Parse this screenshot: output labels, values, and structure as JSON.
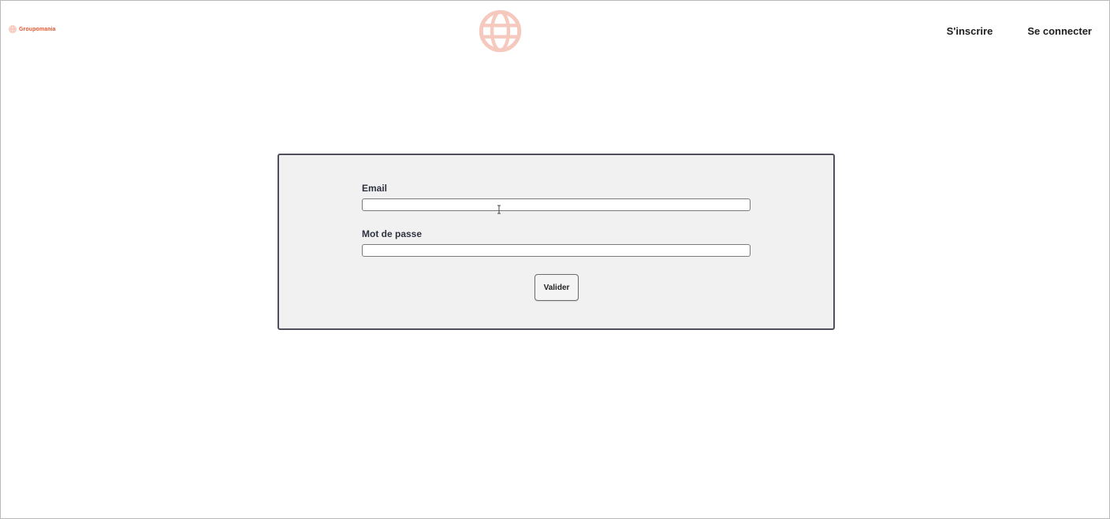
{
  "header": {
    "brand": {
      "icon": "globe-icon",
      "name": "Groupomania",
      "color": "#e8552f"
    },
    "logo": {
      "icon": "globe-icon",
      "color": "#f6c9bf"
    },
    "nav": [
      {
        "label": "S'inscrire"
      },
      {
        "label": "Se connecter"
      }
    ]
  },
  "login_form": {
    "email": {
      "label": "Email",
      "value": "",
      "placeholder": ""
    },
    "password": {
      "label": "Mot de passe",
      "value": "",
      "placeholder": ""
    },
    "submit_label": "Valider"
  },
  "colors": {
    "panel_background": "#f1f1f1",
    "panel_border": "#4f4f5e",
    "accent": "#e8552f"
  }
}
